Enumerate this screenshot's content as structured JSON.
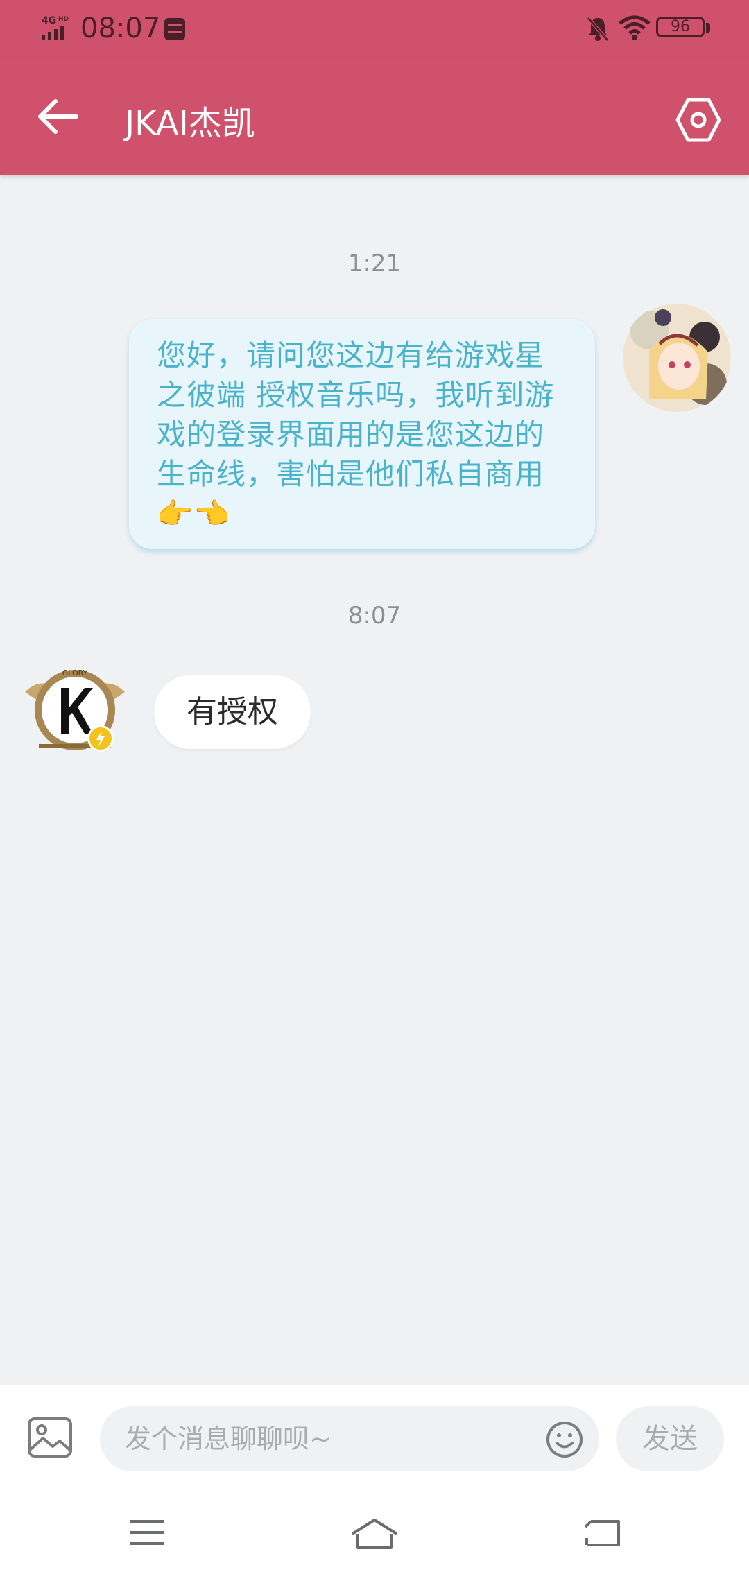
{
  "status_bar": {
    "network": "4G HD",
    "time": "08:07",
    "battery": "96"
  },
  "header": {
    "title": "JKAI杰凯"
  },
  "chat": {
    "timestamps": [
      "1:21",
      "8:07"
    ],
    "outgoing_message": "您好，请问您这边有给游戏星之彼端 授权音乐吗，我听到游戏的登录界面用的是您这边的生命线，害怕是他们私自商用👉👈",
    "incoming_message": "有授权"
  },
  "input": {
    "placeholder": "发个消息聊聊呗~",
    "send_label": "发送"
  },
  "icons": {
    "back": "arrow-left-icon",
    "settings": "hexagon-settings-icon",
    "image": "image-icon",
    "emoji": "smiley-icon",
    "nav": [
      "menu-icon",
      "home-icon",
      "back-nav-icon"
    ]
  },
  "colors": {
    "header": "#d0516b",
    "outgoing_bubble": "#e8f6fc",
    "outgoing_text": "#4ab3cc",
    "background": "#f0f1f3"
  }
}
